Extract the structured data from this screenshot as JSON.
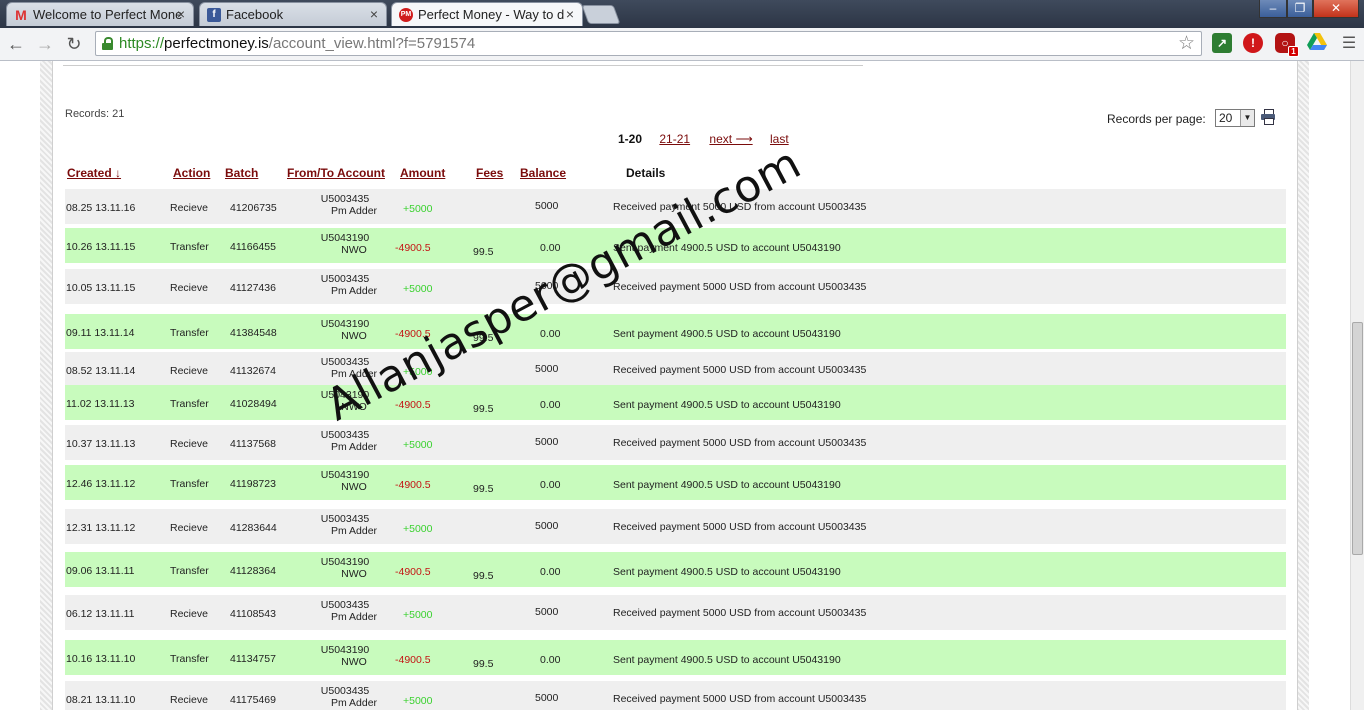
{
  "browser": {
    "tabs": [
      {
        "label": "Welcome to Perfect Mone",
        "icon": "gmail-icon",
        "active": false
      },
      {
        "label": "Facebook",
        "icon": "facebook-icon",
        "active": false
      },
      {
        "label": "Perfect Money - Way to d",
        "icon": "perfect-money-icon",
        "active": true
      }
    ],
    "close_glyph": "×",
    "url": {
      "scheme": "https://",
      "host": "perfectmoney.is",
      "path": "/account_view.html?f=5791574"
    },
    "extensions": [
      "pm-extension-icon",
      "opera-icon",
      "adblock-icon",
      "drive-icon"
    ],
    "extension_badge": "1",
    "window_buttons": {
      "minimize": "–",
      "restore": "❐",
      "close": "✕"
    }
  },
  "page": {
    "records_label": "Records: 21",
    "records_per_page_label": "Records per page:",
    "records_per_page_value": "20",
    "pager": {
      "current": "1-20",
      "page2": "21-21",
      "next": "next ⟶",
      "last": "last"
    },
    "headers": {
      "created": "Created ↓",
      "action": "Action",
      "batch": "Batch",
      "account": "From/To Account",
      "amount": "Amount",
      "fees": "Fees",
      "balance": "Balance",
      "details": "Details"
    },
    "rows": [
      {
        "created": "08.25 13.11.16",
        "action": "Recieve",
        "batch": "41206735",
        "acc1": "U5003435",
        "acc2": "Pm Adder",
        "amount": "+5000",
        "fees": "",
        "balance": "5000",
        "details": "Received payment 5000 USD from account U5003435"
      },
      {
        "created": "10.26 13.11.15",
        "action": "Transfer",
        "batch": "41166455",
        "acc1": "U5043190",
        "acc2": "NWO",
        "amount": "-4900.5",
        "fees": "99.5",
        "balance": "0.00",
        "details": "Sent payment 4900.5 USD to account U5043190"
      },
      {
        "created": "10.05 13.11.15",
        "action": "Recieve",
        "batch": "41127436",
        "acc1": "U5003435",
        "acc2": "Pm Adder",
        "amount": "+5000",
        "fees": "",
        "balance": "5000",
        "details": "Received payment 5000 USD from account U5003435"
      },
      {
        "created": "09.11 13.11.14",
        "action": "Transfer",
        "batch": "41384548",
        "acc1": "U5043190",
        "acc2": "NWO",
        "amount": "-4900.5",
        "fees": "99.5",
        "balance": "0.00",
        "details": "Sent payment 4900.5 USD to account U5043190"
      },
      {
        "created": "08.52 13.11.14",
        "action": "Recieve",
        "batch": "41132674",
        "acc1": "U5003435",
        "acc2": "Pm Adder",
        "amount": "+5000",
        "fees": "",
        "balance": "5000",
        "details": "Received payment 5000 USD from account U5003435"
      },
      {
        "created": "11.02 13.11.13",
        "action": "Transfer",
        "batch": "41028494",
        "acc1": "U5043190",
        "acc2": "NWO",
        "amount": "-4900.5",
        "fees": "99.5",
        "balance": "0.00",
        "details": "Sent payment 4900.5 USD to account U5043190"
      },
      {
        "created": "10.37 13.11.13",
        "action": "Recieve",
        "batch": "41137568",
        "acc1": "U5003435",
        "acc2": "Pm Adder",
        "amount": "+5000",
        "fees": "",
        "balance": "5000",
        "details": "Received payment 5000 USD from account U5003435"
      },
      {
        "created": "12.46 13.11.12",
        "action": "Transfer",
        "batch": "41198723",
        "acc1": "U5043190",
        "acc2": "NWO",
        "amount": "-4900.5",
        "fees": "99.5",
        "balance": "0.00",
        "details": "Sent payment 4900.5 USD to account U5043190"
      },
      {
        "created": "12.31 13.11.12",
        "action": "Recieve",
        "batch": "41283644",
        "acc1": "U5003435",
        "acc2": "Pm Adder",
        "amount": "+5000",
        "fees": "",
        "balance": "5000",
        "details": "Received payment 5000 USD from account U5003435"
      },
      {
        "created": "09.06 13.11.11",
        "action": "Transfer",
        "batch": "41128364",
        "acc1": "U5043190",
        "acc2": "NWO",
        "amount": "-4900.5",
        "fees": "99.5",
        "balance": "0.00",
        "details": "Sent payment 4900.5 USD to account U5043190"
      },
      {
        "created": "06.12 13.11.11",
        "action": "Recieve",
        "batch": "41108543",
        "acc1": "U5003435",
        "acc2": "Pm Adder",
        "amount": "+5000",
        "fees": "",
        "balance": "5000",
        "details": "Received payment 5000 USD from account U5003435"
      },
      {
        "created": "10.16 13.11.10",
        "action": "Transfer",
        "batch": "41134757",
        "acc1": "U5043190",
        "acc2": "NWO",
        "amount": "-4900.5",
        "fees": "99.5",
        "balance": "0.00",
        "details": "Sent payment 4900.5 USD to account U5043190"
      },
      {
        "created": "08.21 13.11.10",
        "action": "Recieve",
        "batch": "41175469",
        "acc1": "U5003435",
        "acc2": "Pm Adder",
        "amount": "+5000",
        "fees": "",
        "balance": "5000",
        "details": "Received payment 5000 USD from account U5003435"
      }
    ],
    "watermark": "Allanjasper@gmail.com"
  },
  "colors": {
    "positive": "#3ad22f",
    "negative": "#c41414",
    "sent_row": "#c8fbbd",
    "recv_row": "#efefef",
    "link": "#7a0b0b"
  }
}
